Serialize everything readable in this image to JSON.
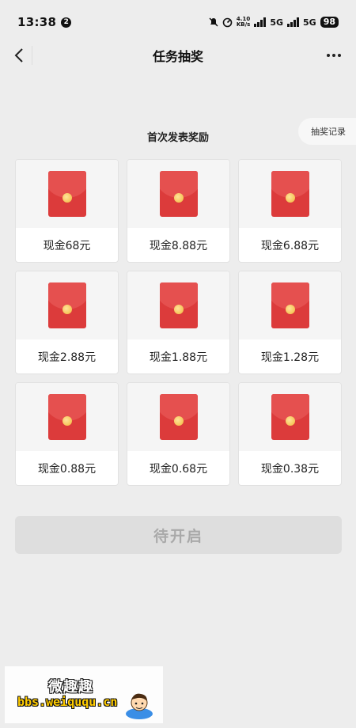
{
  "status_bar": {
    "time": "13:38",
    "notification_count": "2",
    "net_speed_value": "4.10",
    "net_speed_unit": "KB/s",
    "network_1": "5G",
    "network_2": "5G",
    "battery": "98"
  },
  "nav": {
    "title": "任务抽奖",
    "back_icon": "chevron-left-icon",
    "more_icon": "more-dots-icon"
  },
  "history_button": "抽奖记录",
  "section_title": "首次发表奖励",
  "prizes": [
    {
      "label": "现金68元"
    },
    {
      "label": "现金8.88元"
    },
    {
      "label": "现金6.88元"
    },
    {
      "label": "现金2.88元"
    },
    {
      "label": "现金1.88元"
    },
    {
      "label": "现金1.28元"
    },
    {
      "label": "现金0.88元"
    },
    {
      "label": "现金0.68元"
    },
    {
      "label": "现金0.38元"
    }
  ],
  "start_button": "待开启",
  "watermark": {
    "title": "微趣趣",
    "url": "bbs.weiququ.cn"
  },
  "colors": {
    "background": "#ededed",
    "envelope": "#dc3b3b",
    "seal": "#f2b73a",
    "disabled_button": "#dedede"
  }
}
